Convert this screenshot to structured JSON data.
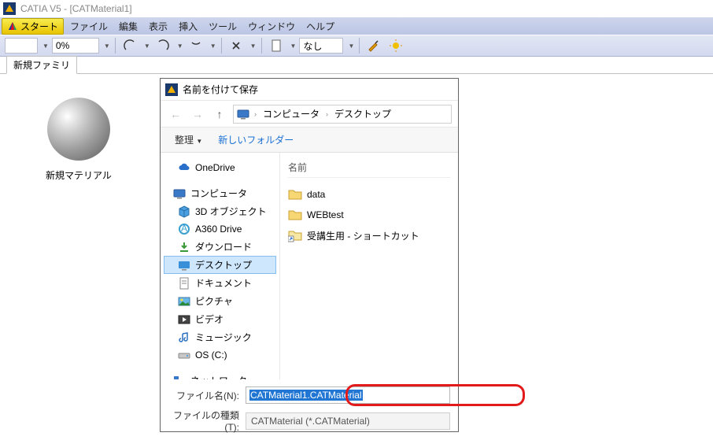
{
  "window": {
    "title": "CATIA V5 - [CATMaterial1]"
  },
  "menubar": {
    "start": "スタート",
    "items": [
      "ファイル",
      "編集",
      "表示",
      "挿入",
      "ツール",
      "ウィンドウ",
      "ヘルプ"
    ]
  },
  "toolbar": {
    "percent_value": "0%",
    "none_label": "なし"
  },
  "tabs": {
    "new_family": "新規ファミリ"
  },
  "viewport": {
    "material_label": "新規マテリアル"
  },
  "dialog": {
    "title": "名前を付けて保存",
    "breadcrumb": {
      "seg1": "コンピュータ",
      "seg2": "デスクトップ"
    },
    "toolbar": {
      "organize": "整理",
      "new_folder": "新しいフォルダー"
    },
    "tree": {
      "onedrive": "OneDrive",
      "computer": "コンピュータ",
      "objects3d": "3D オブジェクト",
      "a360": "A360 Drive",
      "downloads": "ダウンロード",
      "desktop": "デスクトップ",
      "documents": "ドキュメント",
      "pictures": "ピクチャ",
      "videos": "ビデオ",
      "music": "ミュージック",
      "osdrive": "OS (C:)",
      "network": "ネットワーク"
    },
    "list": {
      "header_name": "名前",
      "items": [
        {
          "name": "data",
          "type": "folder"
        },
        {
          "name": "WEBtest",
          "type": "folder"
        },
        {
          "name": "受講生用 - ショートカット",
          "type": "shortcut"
        }
      ]
    },
    "fields": {
      "filename_label": "ファイル名(N):",
      "filename_value": "CATMaterial1.CATMaterial",
      "filetype_label": "ファイルの種類(T):",
      "filetype_value": "CATMaterial (*.CATMaterial)"
    }
  }
}
